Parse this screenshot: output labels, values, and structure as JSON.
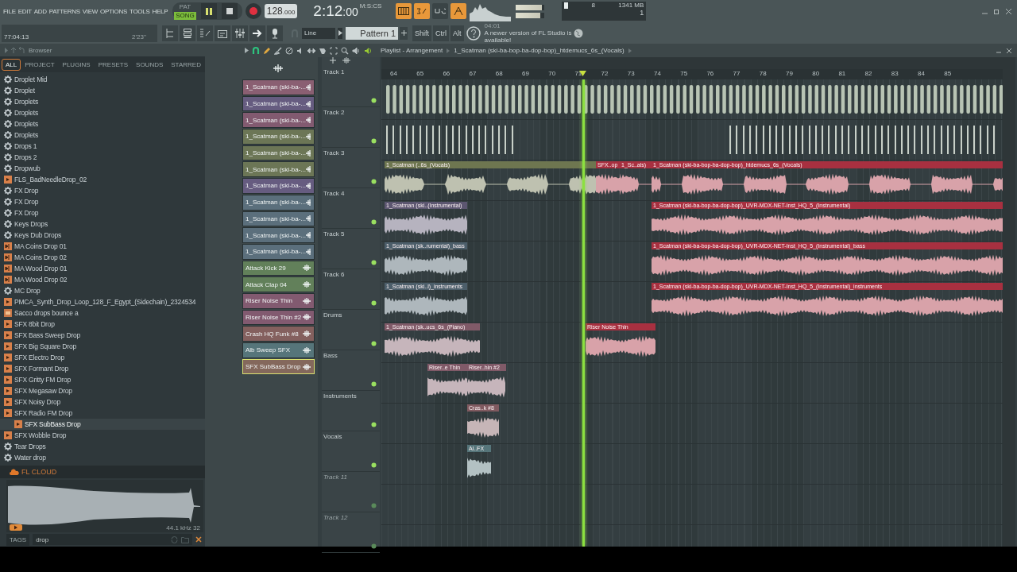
{
  "menu": [
    "FILE",
    "EDIT",
    "ADD",
    "PATTERNS",
    "VIEW",
    "OPTIONS",
    "TOOLS",
    "HELP"
  ],
  "transport": {
    "modes": [
      {
        "label": "PAT",
        "selected": false
      },
      {
        "label": "SONG",
        "selected": true
      }
    ],
    "tempo": "128",
    "tempo_fraction": ".000",
    "time": "2:12",
    "time_sub": ":00",
    "time_unit": "M:S:CS"
  },
  "hint": {
    "position": "77:04:13",
    "length": "2'23''"
  },
  "snap": "Line",
  "pattern": "Pattern 1",
  "modifiers": [
    "Shift",
    "Ctrl",
    "Alt"
  ],
  "news": {
    "time": "04:01",
    "text": "A newer version of FL Studio is available!"
  },
  "cpu": {
    "voices": "8",
    "memory": "1341 MB",
    "polyphony": "1"
  },
  "master": {
    "volume": {
      "level": 0.9
    },
    "pitch": {
      "level": 0.85
    }
  },
  "browser": {
    "title": "Browser",
    "tabs": [
      {
        "label": "ALL",
        "selected": true
      },
      {
        "label": "PROJECT",
        "selected": false
      },
      {
        "label": "PLUGINS",
        "selected": false
      },
      {
        "label": "PRESETS",
        "selected": false
      },
      {
        "label": "SOUNDS",
        "selected": false
      },
      {
        "label": "STARRED",
        "selected": false
      }
    ],
    "items": [
      {
        "name": "Droplet Mid",
        "kind": "preset",
        "selected": false
      },
      {
        "name": "Droplet",
        "kind": "preset",
        "selected": false
      },
      {
        "name": "Droplets",
        "kind": "preset",
        "selected": false
      },
      {
        "name": "Droplets",
        "kind": "preset",
        "selected": false
      },
      {
        "name": "Droplets",
        "kind": "preset",
        "selected": false
      },
      {
        "name": "Droplets",
        "kind": "preset",
        "selected": false
      },
      {
        "name": "Drops 1",
        "kind": "preset",
        "selected": false
      },
      {
        "name": "Drops 2",
        "kind": "preset",
        "selected": false
      },
      {
        "name": "Dropwub",
        "kind": "preset",
        "selected": false
      },
      {
        "name": "FLS_BadNeedleDrop_02",
        "kind": "sample",
        "selected": false
      },
      {
        "name": "FX Drop",
        "kind": "preset",
        "selected": false
      },
      {
        "name": "FX Drop",
        "kind": "preset",
        "selected": false
      },
      {
        "name": "FX Drop",
        "kind": "preset",
        "selected": false
      },
      {
        "name": "Keys Drops",
        "kind": "preset",
        "selected": false
      },
      {
        "name": "Keys Dub Drops",
        "kind": "preset",
        "selected": false
      },
      {
        "name": "MA Coins Drop 01",
        "kind": "loop",
        "selected": false
      },
      {
        "name": "MA Coins Drop 02",
        "kind": "loop",
        "selected": false
      },
      {
        "name": "MA Wood Drop 01",
        "kind": "loop",
        "selected": false
      },
      {
        "name": "MA Wood Drop 02",
        "kind": "loop",
        "selected": false
      },
      {
        "name": "MC Drop",
        "kind": "preset",
        "selected": false
      },
      {
        "name": "PMCA_Synth_Drop_Loop_128_F_Egypt_(Sidechain)_2324534",
        "kind": "sample",
        "selected": false
      },
      {
        "name": "Sacco drops bounce a",
        "kind": "project",
        "selected": false
      },
      {
        "name": "SFX 8bit Drop",
        "kind": "sample",
        "selected": false
      },
      {
        "name": "SFX Bass Sweep Drop",
        "kind": "sample",
        "selected": false
      },
      {
        "name": "SFX Big Square Drop",
        "kind": "sample",
        "selected": false
      },
      {
        "name": "SFX Electro Drop",
        "kind": "sample",
        "selected": false
      },
      {
        "name": "SFX Formant Drop",
        "kind": "sample",
        "selected": false
      },
      {
        "name": "SFX Gritty FM Drop",
        "kind": "sample",
        "selected": false
      },
      {
        "name": "SFX Megasaw Drop",
        "kind": "sample",
        "selected": false
      },
      {
        "name": "SFX Noisy Drop",
        "kind": "sample",
        "selected": false
      },
      {
        "name": "SFX Radio FM Drop",
        "kind": "sample",
        "selected": false
      },
      {
        "name": "SFX SubBass Drop",
        "kind": "sample",
        "selected": true
      },
      {
        "name": "SFX Wobble Drop",
        "kind": "sample",
        "selected": false
      },
      {
        "name": "Tear Drops",
        "kind": "preset",
        "selected": false
      },
      {
        "name": "Water drop",
        "kind": "preset",
        "selected": false
      }
    ],
    "cloud": "FL CLOUD",
    "preview_info": "44.1 kHz 32",
    "tags_label": "TAGS",
    "search_value": "drop"
  },
  "playlist": {
    "title": "Playlist - Arrangement",
    "path": "1_Scatman (ski-ba-bop-ba-dop-bop)_htdemucs_6s_(Vocals)",
    "channels": [
      {
        "name": "1_Scatman (ski-ba-...",
        "color": "#8a5f72",
        "selected": false
      },
      {
        "name": "1_Scatman (ski-ba-...",
        "color": "#665c80",
        "selected": false
      },
      {
        "name": "1_Scatman (ski-ba-...",
        "color": "#825a70",
        "selected": false
      },
      {
        "name": "1_Scatman (ski-ba-...",
        "color": "#6c7656",
        "selected": false
      },
      {
        "name": "1_Scatman (ski-ba-...",
        "color": "#6c7656",
        "selected": false
      },
      {
        "name": "1_Scatman (ski-ba-...",
        "color": "#6c7656",
        "selected": false
      },
      {
        "name": "1_Scatman (ski-ba-...",
        "color": "#665c80",
        "selected": false
      },
      {
        "name": "1_Scatman (ski-ba-...",
        "color": "#5b6f7c",
        "selected": false
      },
      {
        "name": "1_Scatman (ski-ba-...",
        "color": "#5b6f7c",
        "selected": false
      },
      {
        "name": "1_Scatman (ski-ba-...",
        "color": "#5b6f7c",
        "selected": false
      },
      {
        "name": "1_Scatman (ski-ba-...",
        "color": "#5b6f7c",
        "selected": false
      },
      {
        "name": "Attack Kick 29",
        "color": "#62805a",
        "selected": false
      },
      {
        "name": "Attack Clap 04",
        "color": "#62805a",
        "selected": false
      },
      {
        "name": "Riser Noise Thin",
        "color": "#825a70",
        "selected": false
      },
      {
        "name": "Riser Noise Thin #2",
        "color": "#825a70",
        "selected": false
      },
      {
        "name": "Crash HQ Funk #8",
        "color": "#84605e",
        "selected": false
      },
      {
        "name": "Alb Sweep SFX",
        "color": "#56757a",
        "selected": false
      },
      {
        "name": "SFX SubBass Drop",
        "color": "#84685c",
        "selected": true
      }
    ],
    "ruler": [
      "64",
      "65",
      "66",
      "67",
      "68",
      "69",
      "70",
      "71",
      "72",
      "73",
      "74",
      "75",
      "76",
      "77",
      "78",
      "79",
      "80",
      "81",
      "82",
      "83",
      "84",
      "85"
    ],
    "tracks": [
      {
        "name": "Track 1",
        "empty": false,
        "clips": [
          {
            "kind": "pattern",
            "color": "#b8c4b4"
          }
        ]
      },
      {
        "name": "Track 2",
        "empty": false,
        "clips": [
          {
            "kind": "ticks",
            "color": "#c8d0c8"
          },
          {
            "kind": "ticks",
            "color": "#c8d0c8"
          }
        ]
      },
      {
        "name": "Track 3",
        "empty": false,
        "clips": [
          {
            "kind": "audio",
            "label": "1_Scatman (..6s_(Vocals)",
            "color": "#6e7650"
          },
          {
            "kind": "audio",
            "label": "SFX..op",
            "color": "#a83040"
          },
          {
            "kind": "audio",
            "label": "1_Sc..als)",
            "color": "#a83040"
          },
          {
            "kind": "audio",
            "label": "1_Scatman (ski-ba-bop-ba-dop-bop)_htdemucs_6s_(Vocals)",
            "color": "#a83040"
          }
        ]
      },
      {
        "name": "Track 4",
        "empty": false,
        "clips": [
          {
            "kind": "audio",
            "label": "1_Scatman (ski..(Instrumental)",
            "color": "#5c5670"
          },
          {
            "kind": "audio",
            "label": "1_Scatman (ski-ba-bop-ba-dop-bop)_UVR-MDX-NET-Inst_HQ_5_(Instrumental)",
            "color": "#a83040"
          }
        ]
      },
      {
        "name": "Track 5",
        "empty": false,
        "clips": [
          {
            "kind": "audio",
            "label": "1_Scatman (sk..rumental)_bass",
            "color": "#4c5e6a"
          },
          {
            "kind": "audio",
            "label": "1_Scatman (ski-ba-bop-ba-dop-bop)_UVR-MDX-NET-Inst_HQ_5_(Instrumental)_bass",
            "color": "#a83040"
          }
        ]
      },
      {
        "name": "Track 6",
        "empty": false,
        "clips": [
          {
            "kind": "audio",
            "label": "1_Scatman (ski..l)_instruments",
            "color": "#4c5e6a"
          },
          {
            "kind": "audio",
            "label": "1_Scatman (ski-ba-bop-ba-dop-bop)_UVR-MDX-NET-Inst_HQ_5_(Instrumental)_instruments",
            "color": "#a83040"
          }
        ]
      },
      {
        "name": "Drums",
        "empty": false,
        "clips": [
          {
            "kind": "audio",
            "label": "1_Scatman (sk..ucs_6s_(Piano)",
            "color": "#805a68"
          },
          {
            "kind": "audio",
            "label": "Riser Noise Thin",
            "color": "#a83040"
          }
        ]
      },
      {
        "name": "Bass",
        "empty": false,
        "clips": [
          {
            "kind": "audio",
            "label": "Riser..e Thin",
            "color": "#805a68"
          },
          {
            "kind": "audio",
            "label": "Riser..hin #2",
            "color": "#805a68"
          }
        ]
      },
      {
        "name": "Instruments",
        "empty": false,
        "clips": [
          {
            "kind": "audio",
            "label": "Cras..k #8",
            "color": "#805a60"
          }
        ]
      },
      {
        "name": "Vocals",
        "empty": false,
        "clips": [
          {
            "kind": "audio",
            "label": "Al..FX",
            "color": "#56757a"
          }
        ]
      },
      {
        "name": "Track 11",
        "empty": true
      },
      {
        "name": "Track 12",
        "empty": true
      }
    ]
  }
}
